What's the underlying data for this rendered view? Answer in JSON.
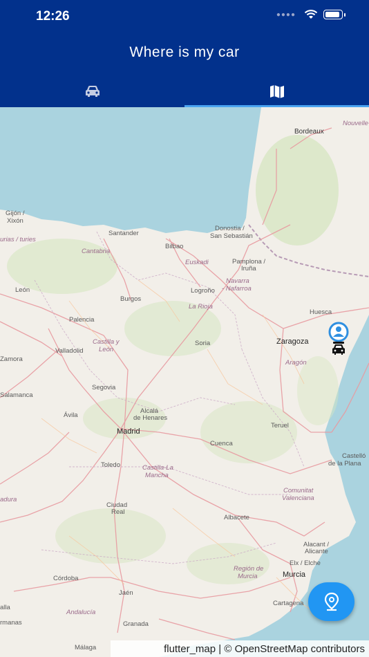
{
  "status_bar": {
    "time": "12:26"
  },
  "app": {
    "title": "Where is my car"
  },
  "tabs": [
    {
      "name": "car",
      "icon": "car-icon",
      "selected": false
    },
    {
      "name": "map",
      "icon": "map-icon",
      "selected": true
    }
  ],
  "colors": {
    "appbar": "#02318c",
    "tab_indicator": "#4aa3f0",
    "fab": "#2196f3",
    "sea": "#aad3df",
    "land": "#f2efe9"
  },
  "map": {
    "labels": {
      "bordeaux": "Bordeaux",
      "aquitaine": "Nouvelle-Aqui",
      "gijon": "Gijón /",
      "xixon": "Xixón",
      "asturias": "urias / turies",
      "santander": "Santander",
      "cantabria": "Cantabria",
      "bilbao": "Bilbao",
      "donostia": "Donostia /",
      "sansebastian": "San Sebastián",
      "euskadi": "Euskadi",
      "pamplona": "Pamplona /",
      "iruna": "Iruña",
      "navarra": "Navarra",
      "nafarroa": "- Nafarroa",
      "leon": "León",
      "burgos": "Burgos",
      "logrono": "Logroño",
      "larioja": "La Rioja",
      "huesca": "Huesca",
      "palencia": "Palencia",
      "castillayleon": "Castilla y",
      "leon2": "León",
      "valladolid": "Valladolid",
      "soria": "Soria",
      "zaragoza": "Zaragoza",
      "aragon": "Aragón",
      "zamora": "Zamora",
      "segovia": "Segovia",
      "salamanca": "Salamanca",
      "avila": "Ávila",
      "alcala": "Alcalá",
      "henares": "de Henares",
      "madrid": "Madrid",
      "teruel": "Teruel",
      "cuenca": "Cuenca",
      "castello": "Castelló",
      "plana": "de la Plana",
      "toledo": "Toledo",
      "castillalamancha": "Castilla-La",
      "mancha": "Mancha",
      "extremadura": "adura",
      "comunitat": "Comunitat",
      "valenciana": "Valenciana",
      "ciudadreal": "Ciudad",
      "real": "Real",
      "albacete": "Albacete",
      "alacant": "Alacant /",
      "alicante": "Alicante",
      "elx": "Elx / Elche",
      "regionmurcia": "Región de",
      "murcia_region": "Murcia",
      "murcia": "Murcia",
      "cordoba": "Córdoba",
      "jaen": "Jaén",
      "cartagena": "Cartagena",
      "andalucia": "Andalucía",
      "granada": "Granada",
      "malaga": "Málaga",
      "alla": "alla",
      "rmanas": "rmanas"
    },
    "attribution": "flutter_map | © OpenStreetMap contributors"
  },
  "markers": [
    {
      "type": "user-location",
      "icon": "person-pin-icon"
    },
    {
      "type": "parked-car",
      "icon": "car-icon"
    }
  ],
  "fab": {
    "icon": "location-pin-icon"
  }
}
